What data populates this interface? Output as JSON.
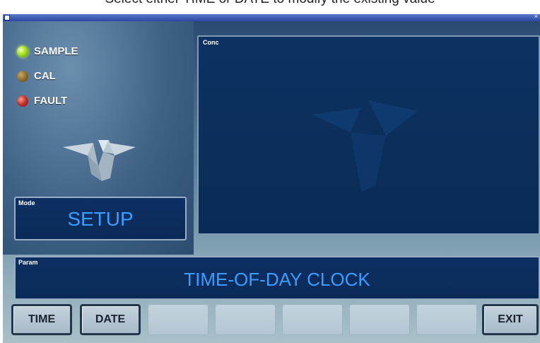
{
  "caption": "Select either TIME or DATE to modify the existing value",
  "window": {
    "indicators": [
      {
        "label": "SAMPLE",
        "state": "on",
        "color": "#a8e21c"
      },
      {
        "label": "CAL",
        "state": "off",
        "color": "#8a6a2a"
      },
      {
        "label": "FAULT",
        "state": "off",
        "color": "#c0302a"
      }
    ],
    "mode": {
      "label": "Mode",
      "value": "SETUP"
    },
    "conc": {
      "label": "Conc"
    },
    "param": {
      "label": "Param",
      "value": "TIME-OF-DAY CLOCK"
    },
    "buttons": [
      {
        "label": "TIME"
      },
      {
        "label": "DATE"
      },
      {
        "label": ""
      },
      {
        "label": ""
      },
      {
        "label": ""
      },
      {
        "label": ""
      },
      {
        "label": ""
      },
      {
        "label": "EXIT"
      }
    ]
  },
  "colors": {
    "display_text": "#3c9cff",
    "display_bg": "#0d2f62",
    "panel_top": "#2a4a73"
  }
}
